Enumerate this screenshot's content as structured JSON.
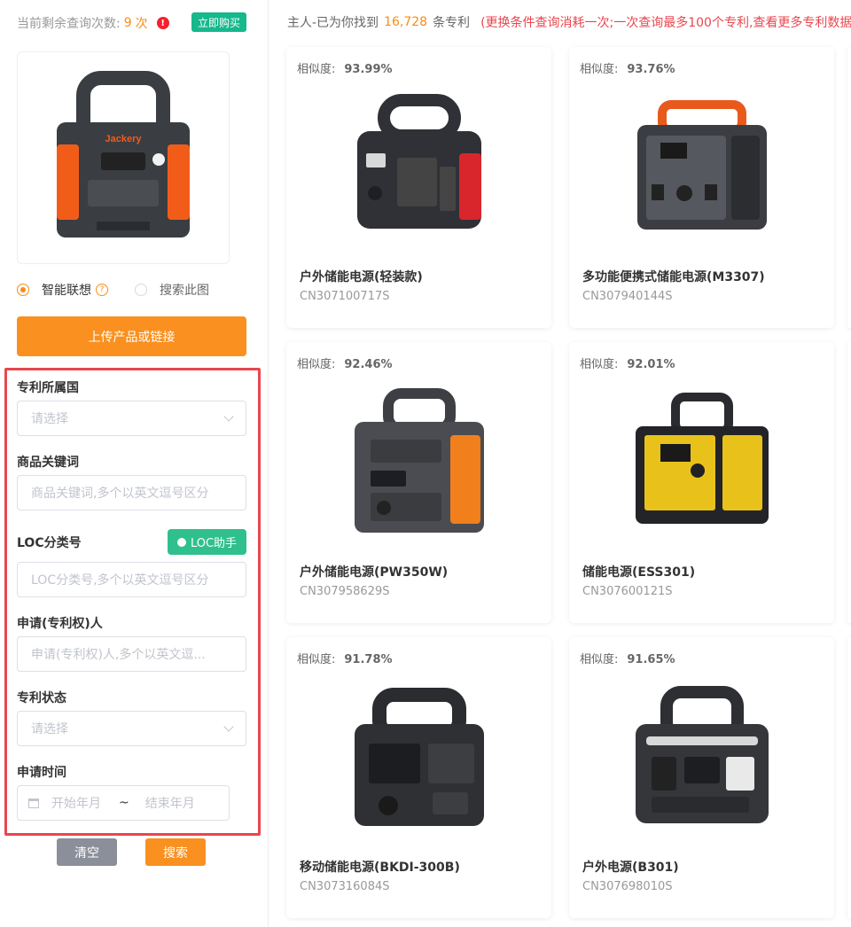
{
  "quota": {
    "label": "当前剩余查询次数:",
    "count": "9",
    "unit": "次",
    "buy_label": "立即购买"
  },
  "search_mode": {
    "option1": "智能联想",
    "option2": "搜索此图"
  },
  "upload_label": "上传产品或链接",
  "filters": {
    "country_label": "专利所属国",
    "country_placeholder": "请选择",
    "keyword_label": "商品关键词",
    "keyword_placeholder": "商品关键词,多个以英文逗号区分",
    "loc_label": "LOC分类号",
    "loc_assistant": "LOC助手",
    "loc_placeholder": "LOC分类号,多个以英文逗号区分",
    "applicant_label": "申请(专利权)人",
    "applicant_placeholder": "申请(专利权)人,多个以英文逗...",
    "status_label": "专利状态",
    "status_placeholder": "请选择",
    "date_label": "申请时间",
    "date_start": "开始年月",
    "date_sep": "~",
    "date_end": "结束年月"
  },
  "actions": {
    "clear": "清空",
    "search": "搜索"
  },
  "results": {
    "prefix": "主人-已为你找到",
    "count": "16,728",
    "suffix": "条专利",
    "note": "(更换条件查询消耗一次;一次查询最多100个专利,查看更多专利数据",
    "similarity_label": "相似度:",
    "cards": [
      {
        "similarity": "93.99%",
        "title": "户外储能电源(轻装款)",
        "code": "CN307100717S"
      },
      {
        "similarity": "93.76%",
        "title": "多功能便携式储能电源(M3307)",
        "code": "CN307940144S"
      },
      {
        "similarity": "92.46%",
        "title": "户外储能电源(PW350W)",
        "code": "CN307958629S"
      },
      {
        "similarity": "92.01%",
        "title": "储能电源(ESS301)",
        "code": "CN307600121S"
      },
      {
        "similarity": "91.78%",
        "title": "移动储能电源(BKDI-300B)",
        "code": "CN307316084S"
      },
      {
        "similarity": "91.65%",
        "title": "户外电源(B301)",
        "code": "CN307698010S"
      }
    ]
  },
  "colors": {
    "accent": "#fa901f",
    "green": "#16b88c",
    "red": "#e8474f"
  }
}
